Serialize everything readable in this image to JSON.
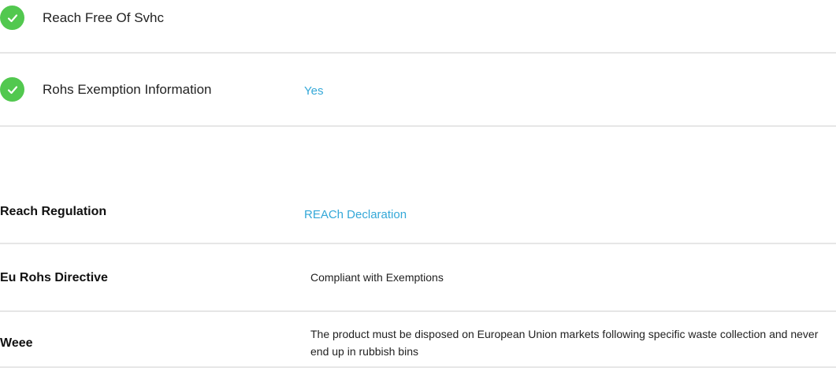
{
  "compliance_checks": [
    {
      "label": "Reach Free Of Svhc",
      "value": "",
      "status_icon": "check-circle-icon",
      "status_color": "#52c84f"
    },
    {
      "label": "Rohs Exemption Information",
      "value": "Yes",
      "status_icon": "check-circle-icon",
      "status_color": "#52c84f"
    }
  ],
  "regulations": [
    {
      "label": "Reach Regulation",
      "value": "REACh Declaration"
    },
    {
      "label": "Eu Rohs Directive",
      "value": "Compliant with Exemptions"
    },
    {
      "label": "Weee",
      "value": "The product must be disposed on European Union markets following specific waste collection and never end up in rubbish bins"
    }
  ],
  "colors": {
    "link": "#34a8d8",
    "check": "#52c84f",
    "divider": "#e6e6e6"
  }
}
